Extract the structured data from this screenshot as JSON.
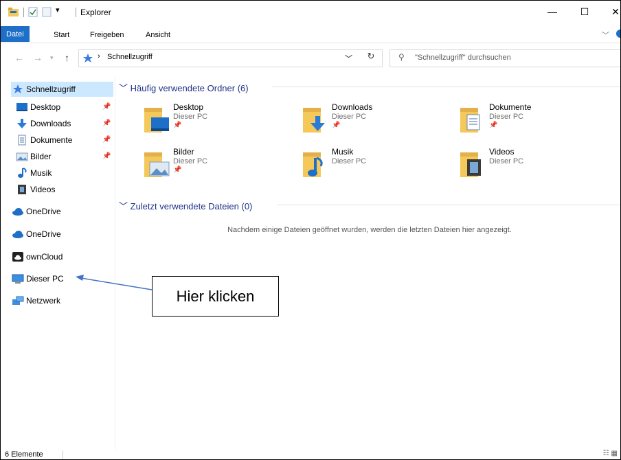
{
  "window": {
    "title": "Explorer",
    "controls": {
      "minimize": "—",
      "maximize": "☐",
      "close": "✕"
    }
  },
  "ribbon": {
    "tabs": [
      {
        "label": "Datei",
        "active": true
      },
      {
        "label": "Start"
      },
      {
        "label": "Freigeben"
      },
      {
        "label": "Ansicht"
      }
    ]
  },
  "address": {
    "path": "Schnellzugriff",
    "search_placeholder": "\"Schnellzugriff\" durchsuchen"
  },
  "sidebar": {
    "quick_access": "Schnellzugriff",
    "items": [
      {
        "label": "Desktop",
        "icon": "desktop-icon",
        "pinned": true
      },
      {
        "label": "Downloads",
        "icon": "download-icon",
        "pinned": true
      },
      {
        "label": "Dokumente",
        "icon": "document-icon",
        "pinned": true
      },
      {
        "label": "Bilder",
        "icon": "pictures-icon",
        "pinned": true
      },
      {
        "label": "Musik",
        "icon": "music-icon",
        "pinned": false
      },
      {
        "label": "Videos",
        "icon": "videos-icon",
        "pinned": false
      }
    ],
    "roots": [
      {
        "label": "OneDrive",
        "icon": "onedrive-icon"
      },
      {
        "label": "OneDrive",
        "icon": "onedrive-icon"
      },
      {
        "label": "ownCloud",
        "icon": "owncloud-icon"
      },
      {
        "label": "Dieser PC",
        "icon": "computer-icon"
      },
      {
        "label": "Netzwerk",
        "icon": "network-icon"
      }
    ]
  },
  "content": {
    "frequent_header": "Häufig verwendete Ordner (6)",
    "folders": [
      {
        "name": "Desktop",
        "location": "Dieser PC",
        "icon": "desktop-folder-icon"
      },
      {
        "name": "Downloads",
        "location": "Dieser PC",
        "icon": "downloads-folder-icon"
      },
      {
        "name": "Dokumente",
        "location": "Dieser PC",
        "icon": "documents-folder-icon"
      },
      {
        "name": "Bilder",
        "location": "Dieser PC",
        "icon": "pictures-folder-icon"
      },
      {
        "name": "Musik",
        "location": "Dieser PC",
        "icon": "music-folder-icon"
      },
      {
        "name": "Videos",
        "location": "Dieser PC",
        "icon": "videos-folder-icon"
      }
    ],
    "recent_header": "Zuletzt verwendete Dateien (0)",
    "recent_empty": "Nachdem einige Dateien geöffnet wurden, werden die letzten Dateien hier angezeigt."
  },
  "callout": {
    "text": "Hier klicken"
  },
  "status": {
    "count": "6 Elemente"
  },
  "colors": {
    "accent": "#1e6fc8",
    "folder": "#f5c85a",
    "selection": "#cce8ff",
    "header_text": "#1e3287"
  }
}
